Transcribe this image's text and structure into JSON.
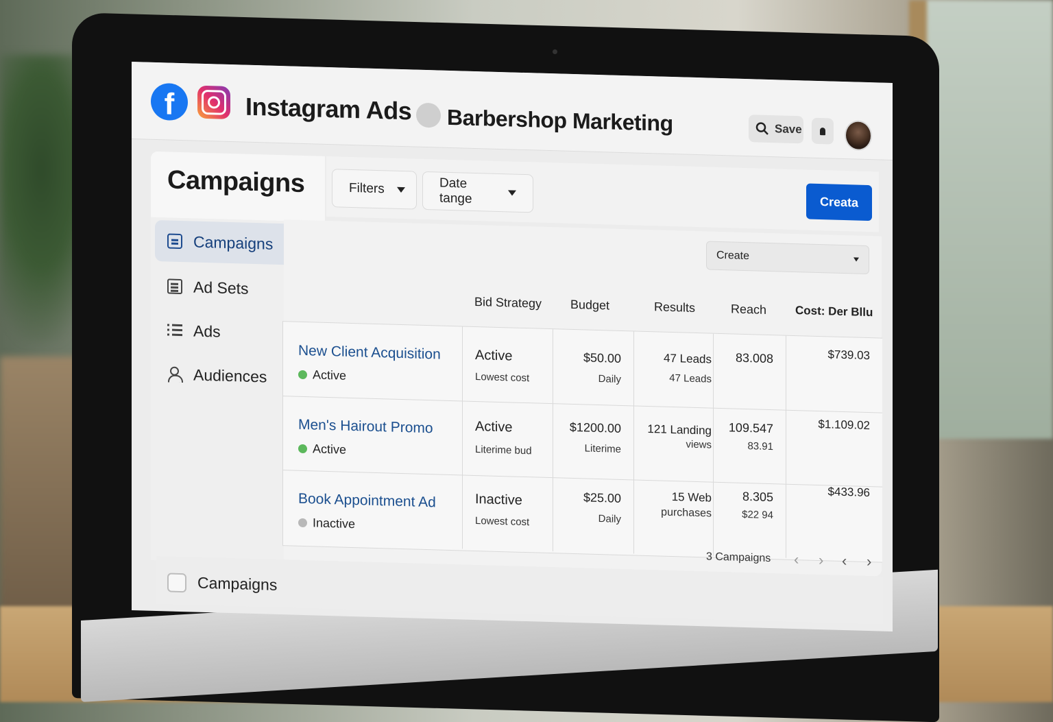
{
  "header": {
    "app_title": "Instagram Ads",
    "account_name": "Barbershop Marketing",
    "search_label": "Save",
    "icons": [
      "facebook-icon",
      "instagram-icon",
      "search-icon",
      "bell-icon"
    ]
  },
  "page": {
    "title": "Campaigns",
    "filters_label": "Filters",
    "date_range_label": "Date tange",
    "create_button": "Creata",
    "create_select": "Create"
  },
  "sidebar": {
    "items": [
      {
        "label": "Campaigns",
        "icon": "campaigns-icon",
        "active": true
      },
      {
        "label": "Ad Sets",
        "icon": "ad-sets-icon",
        "active": false
      },
      {
        "label": "Ads",
        "icon": "ads-icon",
        "active": false
      },
      {
        "label": "Audiences",
        "icon": "audiences-icon",
        "active": false
      }
    ]
  },
  "table": {
    "columns": [
      "Bid Strategy",
      "Budget",
      "Results",
      "Reach",
      "Cost: Der Bllu"
    ],
    "rows": [
      {
        "name": "New Client Acquisition",
        "status": "Active",
        "status_on": true,
        "bid": "Active",
        "bid_sub": "Lowest cost",
        "budget": "$50.00",
        "budget_sub": "Daily",
        "results": "47 Leads",
        "results_sub": "47 Leads",
        "reach": "83.008",
        "reach_sub": "",
        "cost": "$739.03"
      },
      {
        "name": "Men's Hairout Promo",
        "status": "Active",
        "status_on": true,
        "bid": "Active",
        "bid_sub": "Literime bud",
        "budget": "$1200.00",
        "budget_sub": "Literime",
        "results": "121 Landing",
        "results_sub": "views",
        "reach": "109.547",
        "reach_sub": "83.91",
        "cost": "$1.109.02"
      },
      {
        "name": "Book Appointment Ad",
        "status": "Inactive",
        "status_on": false,
        "bid": "Inactive",
        "bid_sub": "Lowest cost",
        "budget": "$25.00",
        "budget_sub": "Daily",
        "results": "15 Web",
        "results_sub": "purchases",
        "reach": "8.305",
        "reach_sub": "$22 94",
        "cost": "$433.96"
      }
    ],
    "count_label": "3 Campaigns"
  },
  "footer": {
    "checkbox_label": "Campaigns"
  },
  "colors": {
    "accent": "#0a5bd0",
    "facebook": "#1877f2",
    "link": "#1b4f8f",
    "active_dot": "#5cb85c",
    "inactive_dot": "#b8b8b8"
  }
}
